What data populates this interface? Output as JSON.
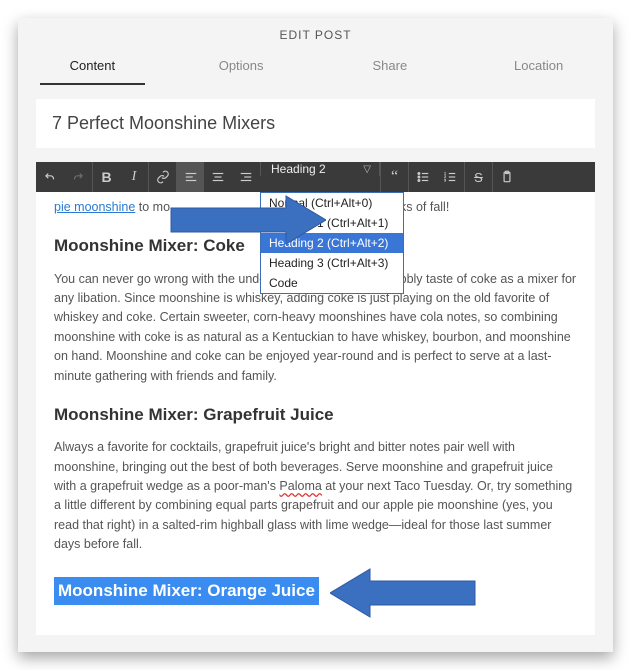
{
  "header": {
    "title": "EDIT POST"
  },
  "tabs": [
    {
      "label": "Content",
      "active": true
    },
    {
      "label": "Options"
    },
    {
      "label": "Share"
    },
    {
      "label": "Location"
    }
  ],
  "post_title": "7 Perfect Moonshine Mixers",
  "toolbar": {
    "format_selected": "Heading 2",
    "dropdown_options": [
      {
        "label": "Normal (Ctrl+Alt+0)"
      },
      {
        "label": "Heading 1 (Ctrl+Alt+1)"
      },
      {
        "label": "Heading 2 (Ctrl+Alt+2)",
        "selected": true
      },
      {
        "label": "Heading 3 (Ctrl+Alt+3)"
      },
      {
        "label": "Code"
      }
    ]
  },
  "body": {
    "intro_fragment_pre": "pie moonshine",
    "intro_fragment_post": " to mo",
    "intro_fragment_tail": "t few weeks of fall!",
    "h2_coke": "Moonshine Mixer: Coke",
    "p_coke": "You can never go wrong with the undeniably refreshing and bubbly taste of coke as a mixer for any libation. Since moonshine is whiskey, adding coke is just playing on the old favorite of whiskey and coke. Certain sweeter, corn-heavy moonshines have cola notes, so combining moonshine with coke is as natural as a Kentuckian to have whiskey, bourbon, and moonshine on hand. Moonshine and coke can be enjoyed year-round and is perfect to serve at a last-minute gathering with friends and family.",
    "h2_grapefruit": "Moonshine Mixer: Grapefruit Juice",
    "p_grapefruit_pre": "Always a favorite for cocktails, grapefruit juice's bright and bitter notes pair well with moonshine, bringing out the best of both beverages. Serve moonshine and grapefruit juice with a grapefruit wedge as a poor-man's ",
    "p_grapefruit_link": "Paloma",
    "p_grapefruit_post": " at your next Taco Tuesday. Or, try something a little different by combining equal parts grapefruit and our apple pie moonshine (yes, you read that right) in a salted-rim highball glass with lime wedge—ideal for those last summer days before fall.",
    "h2_orange": "Moonshine Mixer: Orange Juice"
  }
}
